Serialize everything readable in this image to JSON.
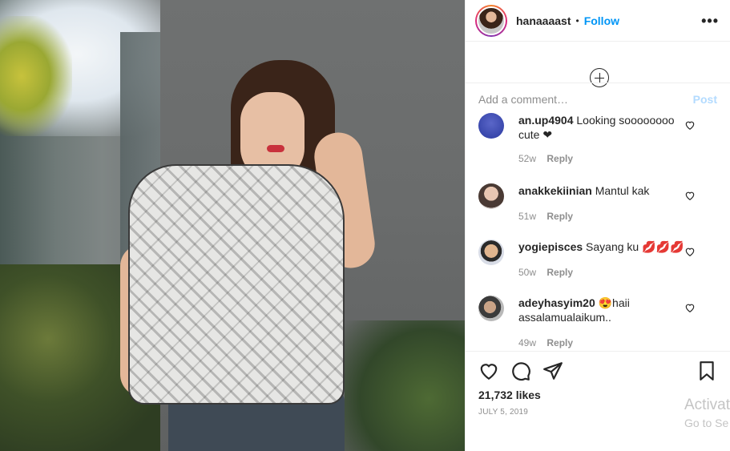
{
  "post": {
    "username": "hanaaaast",
    "separator": "•",
    "follow_label": "Follow",
    "more_label": "•••"
  },
  "comments": [
    {
      "user": "an.up4904",
      "text": "Looking soooooooo cute ❤",
      "time": "52w",
      "reply": "Reply"
    },
    {
      "user": "anakkekiinian",
      "text": "Mantul kak",
      "time": "51w",
      "reply": "Reply"
    },
    {
      "user": "yogiepisces",
      "text": "Sayang ku 💋💋💋",
      "time": "50w",
      "reply": "Reply"
    },
    {
      "user": "adeyhasyim20",
      "text": "😍haii assalamualaikum..",
      "time": "49w",
      "reply": "Reply"
    }
  ],
  "actions": {
    "likes": "21,732 likes",
    "date": "JULY 5, 2019",
    "add_comment_placeholder": "Add a comment…",
    "post_label": "Post"
  },
  "watermark": {
    "line1": "Activat",
    "line2": "Go to Se"
  },
  "icons": {
    "like": "heart-icon",
    "comment": "comment-icon",
    "share": "paper-plane-icon",
    "save": "bookmark-icon",
    "load_more": "plus-circle-icon",
    "comment_like": "heart-outline-icon"
  },
  "colors": {
    "follow": "#0095f6",
    "meta": "#8e8e8e",
    "heart_emoji": "#e0245e"
  }
}
